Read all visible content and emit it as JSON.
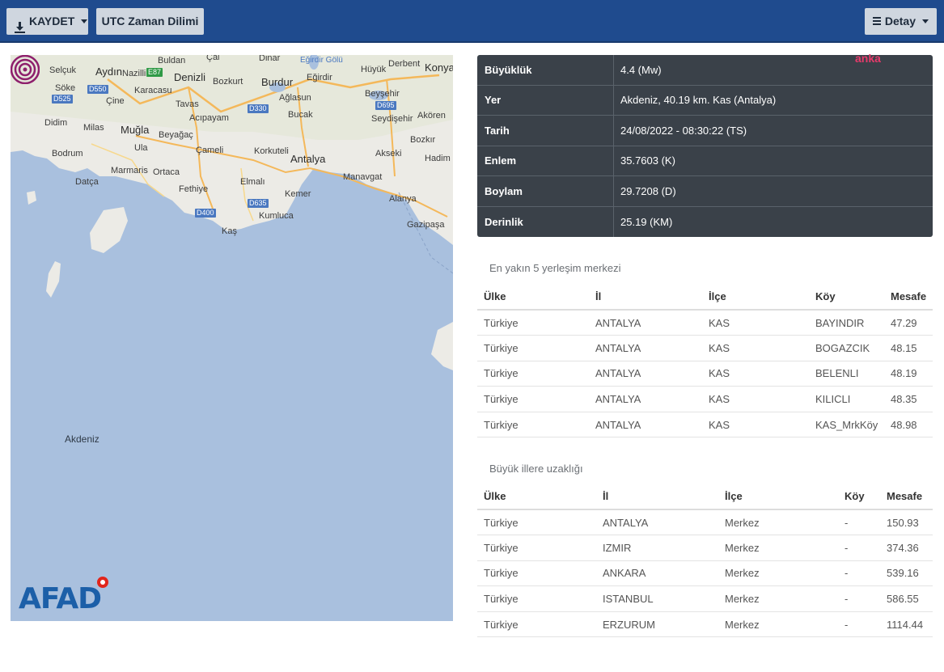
{
  "toolbar": {
    "save_label": "KAYDET",
    "utc_label": "UTC Zaman Dilimi",
    "detail_label": "Detay"
  },
  "watermark": "anka",
  "map": {
    "sea_label": "Akdeniz",
    "cities": [
      "Aydın",
      "Selçuk",
      "Nazilli",
      "Buldan",
      "Çal",
      "Dinar",
      "Eğirdir Gölü",
      "Derbent",
      "Konya",
      "Denizli",
      "Söke",
      "Karacasu",
      "Bozkurt",
      "Burdur",
      "Eğirdir",
      "Hüyük",
      "Çine",
      "Tavas",
      "Ağlasun",
      "Beyşehir",
      "Didim",
      "Acıpayam",
      "Bucak",
      "Seydişehir",
      "Akören",
      "Milas",
      "Muğla",
      "Beyağaç",
      "Ula",
      "Çameli",
      "Korkuteli",
      "Bozkır",
      "Bodrum",
      "Marmaris",
      "Ortaca",
      "Antalya",
      "Akseki",
      "Hadim",
      "Datça",
      "Fethiye",
      "Elmalı",
      "Manavgat",
      "Kemer",
      "Alanya",
      "Kumluca",
      "Gazipaşa",
      "Kaş"
    ],
    "roads": [
      "D550",
      "E87",
      "D525",
      "D330",
      "D695",
      "D400",
      "D635"
    ],
    "logo": "AFAD"
  },
  "info": [
    {
      "key": "Büyüklük",
      "value": "4.4 (Mw)"
    },
    {
      "key": "Yer",
      "value": "Akdeniz, 40.19 km. Kas (Antalya)"
    },
    {
      "key": "Tarih",
      "value": "24/08/2022 - 08:30:22 (TS)"
    },
    {
      "key": "Enlem",
      "value": "35.7603 (K)"
    },
    {
      "key": "Boylam",
      "value": "29.7208 (D)"
    },
    {
      "key": "Derinlik",
      "value": "25.19 (KM)"
    }
  ],
  "nearest": {
    "title": "En yakın 5 yerleşim merkezi",
    "headers": [
      "Ülke",
      "İl",
      "İlçe",
      "Köy",
      "Mesafe"
    ],
    "rows": [
      [
        "Türkiye",
        "ANTALYA",
        "KAS",
        "BAYINDIR",
        "47.29"
      ],
      [
        "Türkiye",
        "ANTALYA",
        "KAS",
        "BOGAZCIK",
        "48.15"
      ],
      [
        "Türkiye",
        "ANTALYA",
        "KAS",
        "BELENLI",
        "48.19"
      ],
      [
        "Türkiye",
        "ANTALYA",
        "KAS",
        "KILICLI",
        "48.35"
      ],
      [
        "Türkiye",
        "ANTALYA",
        "KAS",
        "KAS_MrkKöy",
        "48.98"
      ]
    ]
  },
  "cities_dist": {
    "title": "Büyük illere uzaklığı",
    "headers": [
      "Ülke",
      "İl",
      "İlçe",
      "Köy",
      "Mesafe"
    ],
    "rows": [
      [
        "Türkiye",
        "ANTALYA",
        "Merkez",
        "-",
        "150.93"
      ],
      [
        "Türkiye",
        "IZMIR",
        "Merkez",
        "-",
        "374.36"
      ],
      [
        "Türkiye",
        "ANKARA",
        "Merkez",
        "-",
        "539.16"
      ],
      [
        "Türkiye",
        "ISTANBUL",
        "Merkez",
        "-",
        "586.55"
      ],
      [
        "Türkiye",
        "ERZURUM",
        "Merkez",
        "-",
        "1114.44"
      ]
    ]
  }
}
